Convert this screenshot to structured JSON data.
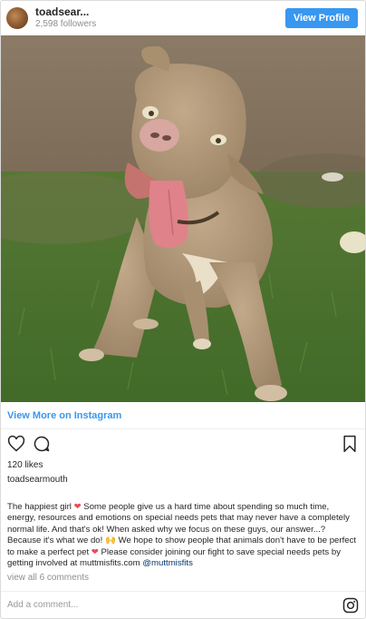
{
  "header": {
    "username": "toadsear...",
    "followers": "2,598 followers",
    "view_profile_label": "View Profile"
  },
  "photo": {
    "subject_icon": "dog-photo"
  },
  "view_more_label": "View More on Instagram",
  "actions": {
    "like_icon": "heart-outline-icon",
    "comment_icon": "comment-bubble-icon",
    "save_icon": "bookmark-icon"
  },
  "likes": "120 likes",
  "owner": "toadsearmouth",
  "caption": {
    "part1": "The happiest girl ",
    "heart1": "❤",
    "part2": " Some people give us a hard time about spending so much time, energy, resources and emotions on special needs pets that may never have a completely normal life. And that's ok! When asked why we focus on these guys, our answer...? Because it's what we do! ",
    "emoji2": "🙌",
    "part3": " We hope to show people that animals don't have to be perfect to make a perfect pet ",
    "heart3": "❤",
    "part4": " Please consider joining our fight to save special needs pets by getting involved at muttmisfits.com ",
    "mention": "@muttmisfits"
  },
  "comments_link": "view all 6 comments",
  "add_comment_placeholder": "Add a comment...",
  "colors": {
    "accent": "#3897f0",
    "heart": "#ed4956",
    "muted": "#8e8e8e"
  }
}
